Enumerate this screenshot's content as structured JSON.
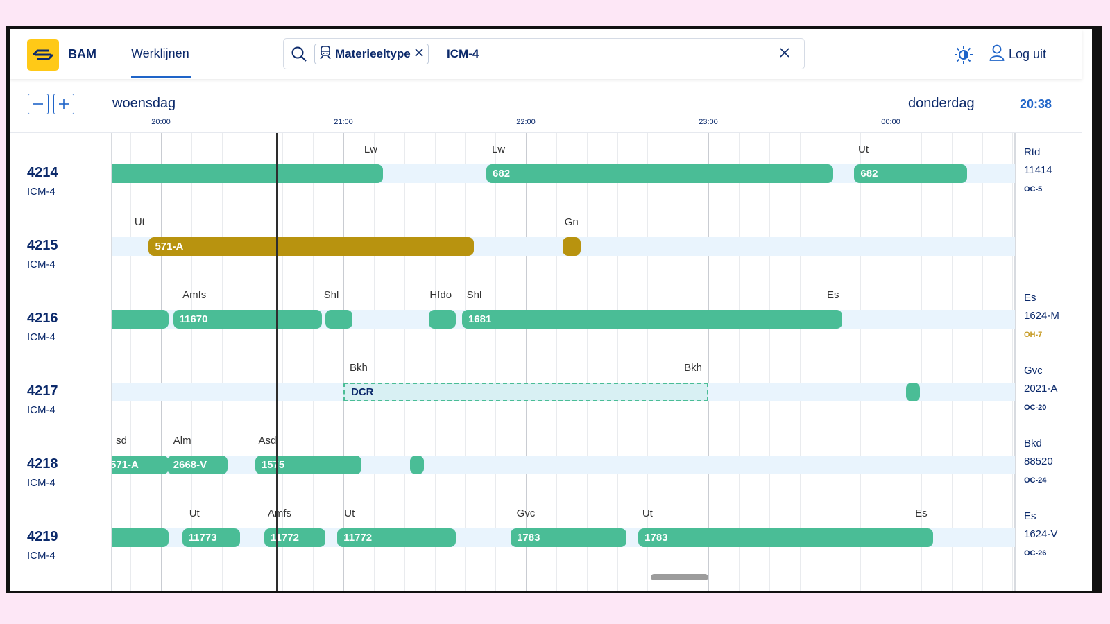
{
  "header": {
    "brand": "BAM",
    "nav_tab": "Werklijnen",
    "search": {
      "chip_label": "Materieeltype",
      "value": "ICM-4"
    },
    "logout_label": "Log uit"
  },
  "toolbar": {
    "day_left": "woensdag",
    "day_right": "donderdag",
    "current_time": "20:38",
    "ticks": [
      "20:00",
      "21:00",
      "22:00",
      "23:00",
      "00:00"
    ]
  },
  "rows": [
    {
      "id": "4214",
      "type": "ICM-4",
      "right": [
        "Rtd",
        "11414",
        "OC-5"
      ],
      "bars": [
        {
          "label": "",
          "style": "green",
          "start": "19:58",
          "end": "21:13"
        },
        {
          "label": "682",
          "style": "green",
          "start": "21:47",
          "end": "23:41"
        },
        {
          "label": "682",
          "style": "green",
          "start": "23:48",
          "end": "00:25"
        }
      ],
      "locations": [
        {
          "text": "Lw",
          "time": "21:09"
        },
        {
          "text": "Lw",
          "time": "21:51"
        },
        {
          "text": "Ut",
          "time": "23:51"
        }
      ]
    },
    {
      "id": "4215",
      "type": "ICM-4",
      "right": [
        "",
        "",
        ""
      ],
      "bars": [
        {
          "label": "571-A",
          "style": "gold",
          "start": "19:56",
          "end": "21:43"
        },
        {
          "label": "",
          "style": "gold",
          "start": "22:12",
          "end": "22:18"
        }
      ],
      "locations": [
        {
          "text": "Ut",
          "time": "19:53"
        },
        {
          "text": "Gn",
          "time": "22:15"
        }
      ]
    },
    {
      "id": "4216",
      "type": "ICM-4",
      "right": [
        "Es",
        "1624-M",
        "OH-7"
      ],
      "bars": [
        {
          "label": "",
          "style": "green",
          "start": "19:58",
          "end": "19:52"
        },
        {
          "label": "11670",
          "style": "green",
          "start": "20:04",
          "end": "20:53"
        },
        {
          "label": "",
          "style": "green",
          "start": "20:54",
          "end": "21:03"
        },
        {
          "label": "",
          "style": "green",
          "start": "21:28",
          "end": "21:37"
        },
        {
          "label": "1681",
          "style": "green",
          "start": "21:39",
          "end": "23:44"
        }
      ],
      "locations": [
        {
          "text": "Amfs",
          "time": "20:11"
        },
        {
          "text": "Shl",
          "time": "20:56"
        },
        {
          "text": "Hfdo",
          "time": "21:32"
        },
        {
          "text": "Shl",
          "time": "21:43"
        },
        {
          "text": "Es",
          "time": "23:41"
        }
      ]
    },
    {
      "id": "4217",
      "type": "ICM-4",
      "right": [
        "Gvc",
        "2021-A",
        "OC-20"
      ],
      "bars": [
        {
          "label": "DCR",
          "style": "dashed",
          "start": "21:00",
          "end": "23:00"
        },
        {
          "label": "",
          "style": "green",
          "start": "00:05",
          "end": "00:09"
        }
      ],
      "locations": [
        {
          "text": "Bkh",
          "time": "21:05"
        },
        {
          "text": "Bkh",
          "time": "22:55"
        }
      ]
    },
    {
      "id": "4218",
      "type": "ICM-4",
      "right": [
        "Bkd",
        "88520",
        "OC-24"
      ],
      "bars": [
        {
          "label": "571-A",
          "style": "green",
          "start": "19:58",
          "end": "19:57"
        },
        {
          "label": "2668-V",
          "style": "green",
          "start": "20:02",
          "end": "20:22"
        },
        {
          "label": "1575",
          "style": "green",
          "start": "20:31",
          "end": "21:06"
        },
        {
          "label": "",
          "style": "green",
          "start": "21:22",
          "end": "21:26"
        }
      ],
      "locations": [
        {
          "text": "sd",
          "time": "19:47"
        },
        {
          "text": "Alm",
          "time": "20:07"
        },
        {
          "text": "Asd",
          "time": "20:35"
        }
      ]
    },
    {
      "id": "4219",
      "type": "ICM-4",
      "right": [
        "Es",
        "1624-V",
        "OC-26"
      ],
      "bars": [
        {
          "label": "",
          "style": "green",
          "start": "19:58",
          "end": "20:02"
        },
        {
          "label": "11773",
          "style": "green",
          "start": "20:07",
          "end": "20:26"
        },
        {
          "label": "11772",
          "style": "green",
          "start": "20:34",
          "end": "20:54"
        },
        {
          "label": "11772",
          "style": "green",
          "start": "20:58",
          "end": "21:37"
        },
        {
          "label": "1783",
          "style": "green",
          "start": "21:55",
          "end": "22:33"
        },
        {
          "label": "1783",
          "style": "green",
          "start": "22:37",
          "end": "00:14"
        }
      ],
      "locations": [
        {
          "text": "Ut",
          "time": "20:11"
        },
        {
          "text": "Amfs",
          "time": "20:39"
        },
        {
          "text": "Ut",
          "time": "21:02"
        },
        {
          "text": "Gvc",
          "time": "22:00"
        },
        {
          "text": "Ut",
          "time": "22:40"
        },
        {
          "text": "Es",
          "time": "00:10"
        }
      ]
    }
  ]
}
